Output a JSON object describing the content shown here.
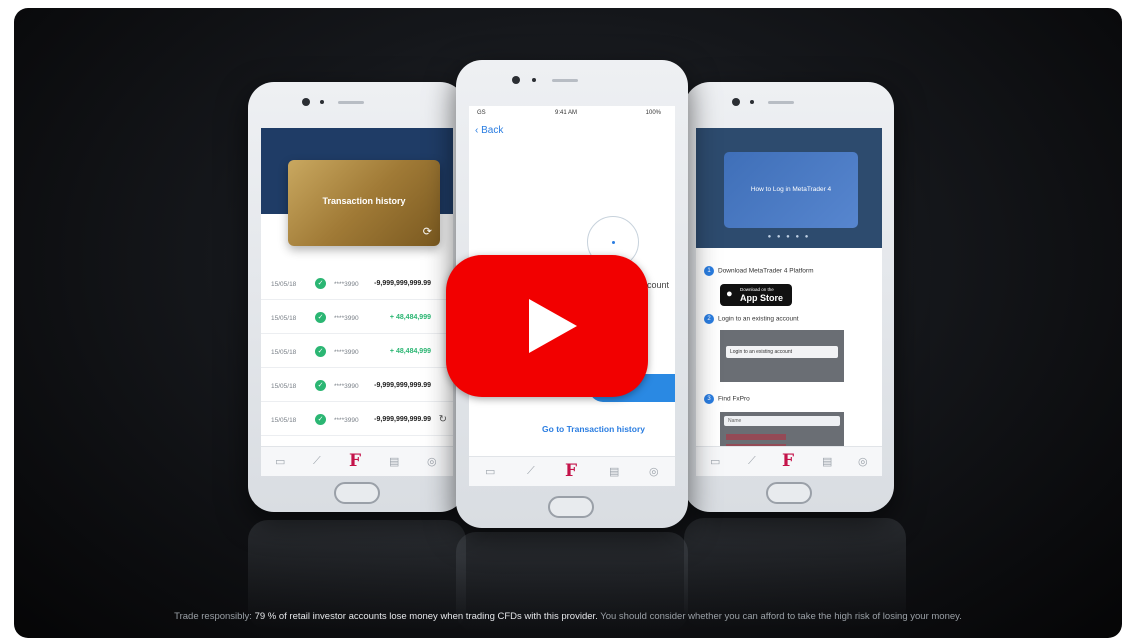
{
  "video": {
    "play_button_label": "Play",
    "disclaimer_prefix": "Trade responsibly: ",
    "disclaimer_highlight": "79 % of retail investor accounts lose money when trading CFDs with this provider.",
    "disclaimer_suffix": " You should consider whether you can afford to take the high risk of losing your money."
  },
  "left_phone": {
    "card_title": "Transaction history",
    "transactions": [
      {
        "date": "15/05/18",
        "account": "****3990",
        "amount": "-9,999,999,999.99",
        "positive": false
      },
      {
        "date": "15/05/18",
        "account": "****3990",
        "amount": "+ 48,484,999",
        "positive": true
      },
      {
        "date": "15/05/18",
        "account": "****3990",
        "amount": "+ 48,484,999",
        "positive": true
      },
      {
        "date": "15/05/18",
        "account": "****3990",
        "amount": "-9,999,999,999.99",
        "positive": false
      },
      {
        "date": "15/05/18",
        "account": "****3990",
        "amount": "-9,999,999,999.99",
        "positive": false
      }
    ]
  },
  "middle_phone": {
    "carrier": "GS",
    "time": "9:41 AM",
    "battery": "100%",
    "back_label": "Back",
    "account_text": "ccount",
    "go_link": "Go to Transaction history"
  },
  "right_phone": {
    "card_title": "How to Log in MetaTrader 4",
    "step1": "Download MetaTrader 4 Platform",
    "step1_num": "1",
    "appstore_small": "Download on the",
    "appstore_big": "App Store",
    "step2": "Login to an existing account",
    "step2_num": "2",
    "shot1_text": "Login to an existing account",
    "step3": "Find FxPro",
    "step3_num": "3",
    "shot2_text": "Name"
  },
  "tab_letter": "F",
  "colors": {
    "play_red": "#f20000",
    "brand_magenta": "#c4134a",
    "link_blue": "#2a7de1",
    "positive_green": "#2bb673"
  }
}
